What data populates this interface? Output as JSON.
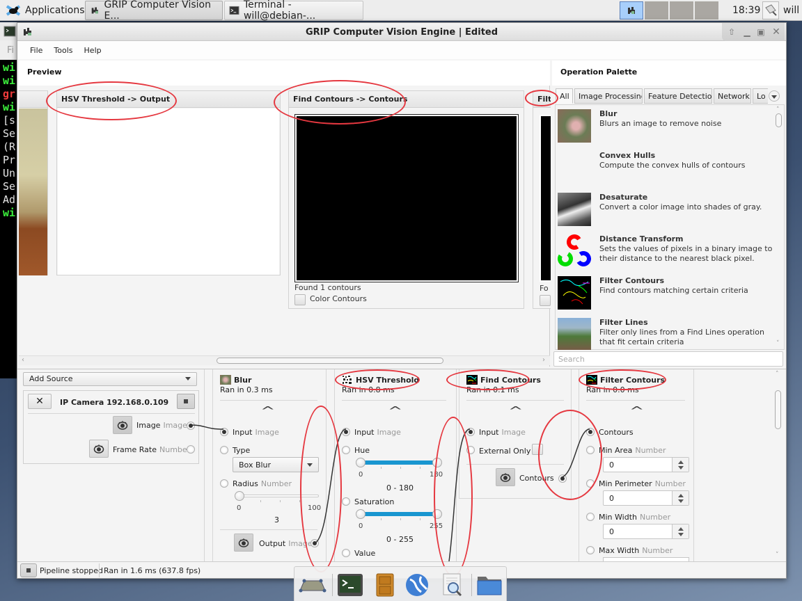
{
  "taskbar": {
    "applications_label": "Applications",
    "tasks": [
      {
        "label": "GRIP Computer Vision E...",
        "active": true
      },
      {
        "label": "Terminal - will@debian-...",
        "active": false
      }
    ],
    "clock": "18:39",
    "user": "will"
  },
  "terminal": {
    "menu_fragment": "Fi",
    "lines": [
      {
        "text": "wi",
        "color": "#3df33d"
      },
      {
        "text": "wi",
        "color": "#3df33d"
      },
      {
        "text": "gr",
        "color": "#f03c3c"
      },
      {
        "text": "wi",
        "color": "#3df33d"
      },
      {
        "text": "[s",
        "color": "#e8e8e8"
      },
      {
        "text": "Se",
        "color": "#e8e8e8"
      },
      {
        "text": "(R",
        "color": "#e8e8e8"
      },
      {
        "text": "Pr",
        "color": "#e8e8e8"
      },
      {
        "text": "Un",
        "color": "#e8e8e8"
      },
      {
        "text": "Se",
        "color": "#e8e8e8"
      },
      {
        "text": "Ad",
        "color": "#e8e8e8"
      },
      {
        "text": "wi",
        "color": "#3df33d"
      }
    ]
  },
  "window": {
    "title": "GRIP Computer Vision Engine | Edited",
    "menu": [
      "File",
      "Tools",
      "Help"
    ]
  },
  "preview": {
    "title": "Preview",
    "cards": [
      {
        "title": "HSV Threshold -> Output"
      },
      {
        "title": "Find Contours -> Contours",
        "status": "Found 1 contours",
        "checkbox_label": "Color Contours"
      },
      {
        "title": "Filter Contours -> Contours",
        "title_visible": "Filt",
        "status_visible": "Fo"
      }
    ]
  },
  "palette": {
    "title": "Operation Palette",
    "tabs": [
      "All",
      "Image Processing",
      "Feature Detection",
      "Network",
      "Lo"
    ],
    "active_tab": "All",
    "operations": [
      {
        "name": "Blur",
        "description": "Blurs an image to remove noise"
      },
      {
        "name": "Convex Hulls",
        "description": "Compute the convex hulls of contours"
      },
      {
        "name": "Desaturate",
        "description": "Convert a color image into shades of gray."
      },
      {
        "name": "Distance Transform",
        "description": "Sets the values of pixels in a binary image to their distance to the nearest black pixel."
      },
      {
        "name": "Filter Contours",
        "description": "Find contours matching certain criteria"
      },
      {
        "name": "Filter Lines",
        "description": "Filter only lines from a Find Lines operation that fit certain criteria"
      }
    ],
    "search_placeholder": "Search"
  },
  "pipeline": {
    "add_source_label": "Add Source",
    "source": {
      "name": "IP Camera 192.168.0.109",
      "outputs": [
        {
          "label": "Image",
          "type": "Image"
        },
        {
          "label": "Frame Rate",
          "type": "Number"
        }
      ]
    },
    "steps": {
      "blur": {
        "title": "Blur",
        "ran": "Ran in 0.3 ms",
        "input_label": "Input",
        "input_type": "Image",
        "type_label": "Type",
        "type_value": "Box Blur",
        "radius_label": "Radius",
        "radius_type": "Number",
        "radius_min": "0",
        "radius_max": "100",
        "radius_value": "3",
        "output_label": "Output",
        "output_type": "Image"
      },
      "hsv": {
        "title": "HSV Threshold",
        "ran": "Ran in 0.8 ms",
        "input_label": "Input",
        "input_type": "Image",
        "hue_label": "Hue",
        "hue_min": "0",
        "hue_max": "180",
        "hue_range": "0 - 180",
        "sat_label": "Saturation",
        "sat_min": "0",
        "sat_max": "255",
        "sat_range": "0 - 255",
        "value_label": "Value"
      },
      "find": {
        "title": "Find Contours",
        "ran": "Ran in 0.1 ms",
        "input_label": "Input",
        "input_type": "Image",
        "external_label": "External Only",
        "output_label": "Contours"
      },
      "filter": {
        "title": "Filter Contours",
        "ran": "Ran in 0.0 ms",
        "contours_label": "Contours",
        "params": [
          {
            "label": "Min Area",
            "type": "Number",
            "value": "0"
          },
          {
            "label": "Min Perimeter",
            "type": "Number",
            "value": "0"
          },
          {
            "label": "Min Width",
            "type": "Number",
            "value": "0"
          },
          {
            "label": "Max Width",
            "type": "Number",
            "value": ""
          }
        ]
      }
    }
  },
  "status": {
    "state": "Pipeline stopped",
    "timing": "Ran in 1.6 ms (637.8 fps)"
  },
  "colors": {
    "accent": "#1996d0",
    "annotation": "#e53840"
  }
}
